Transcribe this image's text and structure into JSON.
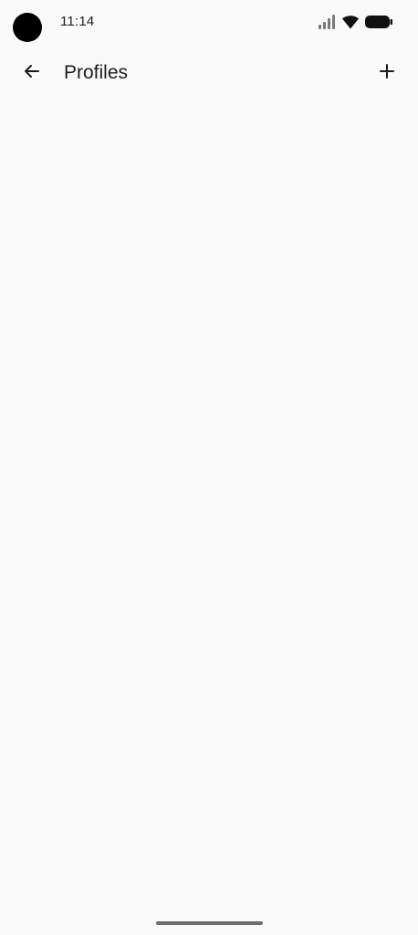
{
  "status_bar": {
    "time": "11:14",
    "icons": [
      "signal-icon",
      "wifi-icon",
      "battery-icon"
    ]
  },
  "app_bar": {
    "title": "Profiles",
    "back_icon": "arrow-left-icon",
    "add_icon": "plus-icon"
  },
  "colors": {
    "background": "#fafafa",
    "text": "#1c1c1c",
    "gesture_bar": "#6e6e6e"
  }
}
